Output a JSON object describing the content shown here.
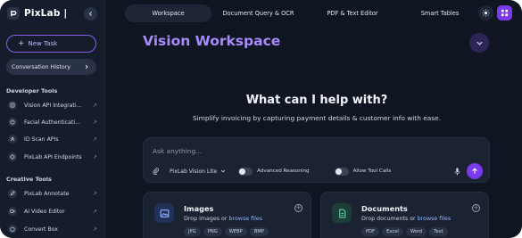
{
  "brand": {
    "name": "PixLab |"
  },
  "sidebar": {
    "new_task_label": "New Task",
    "conversation_history_label": "Conversation History",
    "sections": [
      {
        "title": "Developer Tools",
        "items": [
          {
            "label": "Vision API Integrati...",
            "icon": "vision-icon"
          },
          {
            "label": "Facial Authenticati...",
            "icon": "face-icon"
          },
          {
            "label": "ID Scan APIs",
            "icon": "id-card-icon"
          },
          {
            "label": "PixLab API Endpoints",
            "icon": "endpoints-icon"
          }
        ]
      },
      {
        "title": "Creative Tools",
        "items": [
          {
            "label": "PixLab Annotate",
            "icon": "pencil-icon"
          },
          {
            "label": "AI Video Editor",
            "icon": "video-icon"
          },
          {
            "label": "Convert Box",
            "icon": "box-icon"
          }
        ]
      }
    ]
  },
  "topnav": {
    "tabs": [
      {
        "label": "Workspace",
        "active": true
      },
      {
        "label": "Document Query & OCR",
        "active": false
      },
      {
        "label": "PDF & Text Editor",
        "active": false
      },
      {
        "label": "Smart Tables",
        "active": false
      }
    ]
  },
  "main": {
    "title": "Vision Workspace",
    "headline": "What can I help with?",
    "subline": "Simplify invoicing by capturing payment details & customer info with ease.",
    "ask": {
      "placeholder": "Ask anything...",
      "model_label": "PixLab Vision Lite",
      "advanced_reasoning_label": "Advanced Reasoning",
      "allow_tool_calls_label": "Allow Tool Calls"
    },
    "cards": [
      {
        "title": "Images",
        "desc_prefix": "Drop images or ",
        "desc_link": "browse files",
        "chips": [
          "JPG",
          "PNG",
          "WEBP",
          "BMP"
        ]
      },
      {
        "title": "Documents",
        "desc_prefix": "Drop documents or ",
        "desc_link": "browse files",
        "chips": [
          "PDF",
          "Excel",
          "Word",
          "Text"
        ]
      }
    ]
  },
  "colors": {
    "accent": "#8b5cf6",
    "background": "#0f1521",
    "sidebar": "#151c2b",
    "title": "#a78bfa",
    "link": "#8fb3ff"
  }
}
